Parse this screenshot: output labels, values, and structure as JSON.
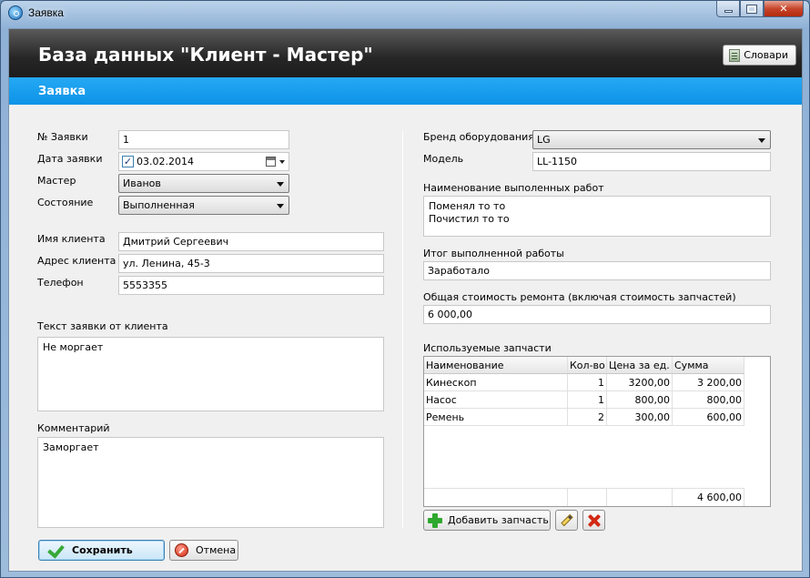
{
  "window": {
    "title": "Заявка"
  },
  "header": {
    "app_title": "База данных \"Клиент - Мастер\"",
    "dict_button": "Словари"
  },
  "section": {
    "title": "Заявка"
  },
  "left": {
    "request_no_label": "№ Заявки",
    "request_no_value": "1",
    "request_date_label": "Дата заявки",
    "request_date_value": "03.02.2014",
    "request_date_checked": true,
    "master_label": "Мастер",
    "master_value": "Иванов",
    "state_label": "Состояние",
    "state_value": "Выполненная",
    "client_name_label": "Имя клиента",
    "client_name_value": "Дмитрий Сергеевич",
    "client_address_label": "Адрес клиента",
    "client_address_value": "ул. Ленина, 45-3",
    "phone_label": "Телефон",
    "phone_value": "5553355",
    "request_text_label": "Текст заявки от клиента",
    "request_text_value": "Не моргает",
    "comment_label": "Комментарий",
    "comment_value": "Заморгает"
  },
  "right": {
    "brand_label": "Бренд оборудования",
    "brand_value": "LG",
    "model_label": "Модель",
    "model_value": "LL-1150",
    "works_label": "Наименование выполенных работ",
    "works_value": "Поменял то то\nПочистил то то",
    "result_label": "Итог выполненной работы",
    "result_value": "Заработало",
    "total_cost_label": "Общая стоимость ремонта (включая стоимость запчастей)",
    "total_cost_value": "6 000,00",
    "parts_label": "Используемые запчасти"
  },
  "parts_table": {
    "columns": [
      "Наименование",
      "Кол-во",
      "Цена за ед.",
      "Сумма"
    ],
    "rows": [
      [
        "Кинескоп",
        "1",
        "3200,00",
        "3 200,00"
      ],
      [
        "Насос",
        "1",
        "800,00",
        "800,00"
      ],
      [
        "Ремень",
        "2",
        "300,00",
        "600,00"
      ]
    ],
    "total": "4 600,00"
  },
  "buttons": {
    "add_part": "Добавить запчасть",
    "save": "Сохранить",
    "cancel": "Отмена"
  },
  "icons": {
    "app": "search-globe-icon",
    "dict": "book-icon",
    "add": "plus-icon",
    "edit": "pencil-icon",
    "delete": "delete-x-icon",
    "save": "checkmark-icon",
    "cancel": "stop-icon"
  },
  "colors": {
    "header_dark": "#262626",
    "section_blue": "#0d93e8",
    "add_green": "#2fa82f",
    "delete_red": "#d32a14"
  }
}
